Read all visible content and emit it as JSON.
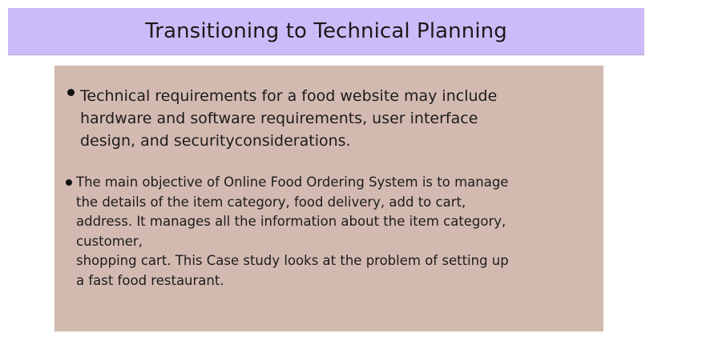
{
  "slide": {
    "title": "Transitioning to Technical Planning",
    "bullets": [
      {
        "text": "Technical requirements for a food website may include\nhardware and software requirements, user interface\ndesign, and securityconsiderations."
      },
      {
        "text": "The main objective of Online Food Ordering System is to manage\nthe details of the item category, food delivery, add to cart,\naddress. It manages all the information about the item category,\ncustomer,\nshopping cart. This Case study looks at the problem of setting up\na fast food restaurant."
      }
    ]
  },
  "colors": {
    "title_background": "#cbbcf9",
    "content_background": "#d3bab1",
    "text": "#1c1c1c"
  }
}
